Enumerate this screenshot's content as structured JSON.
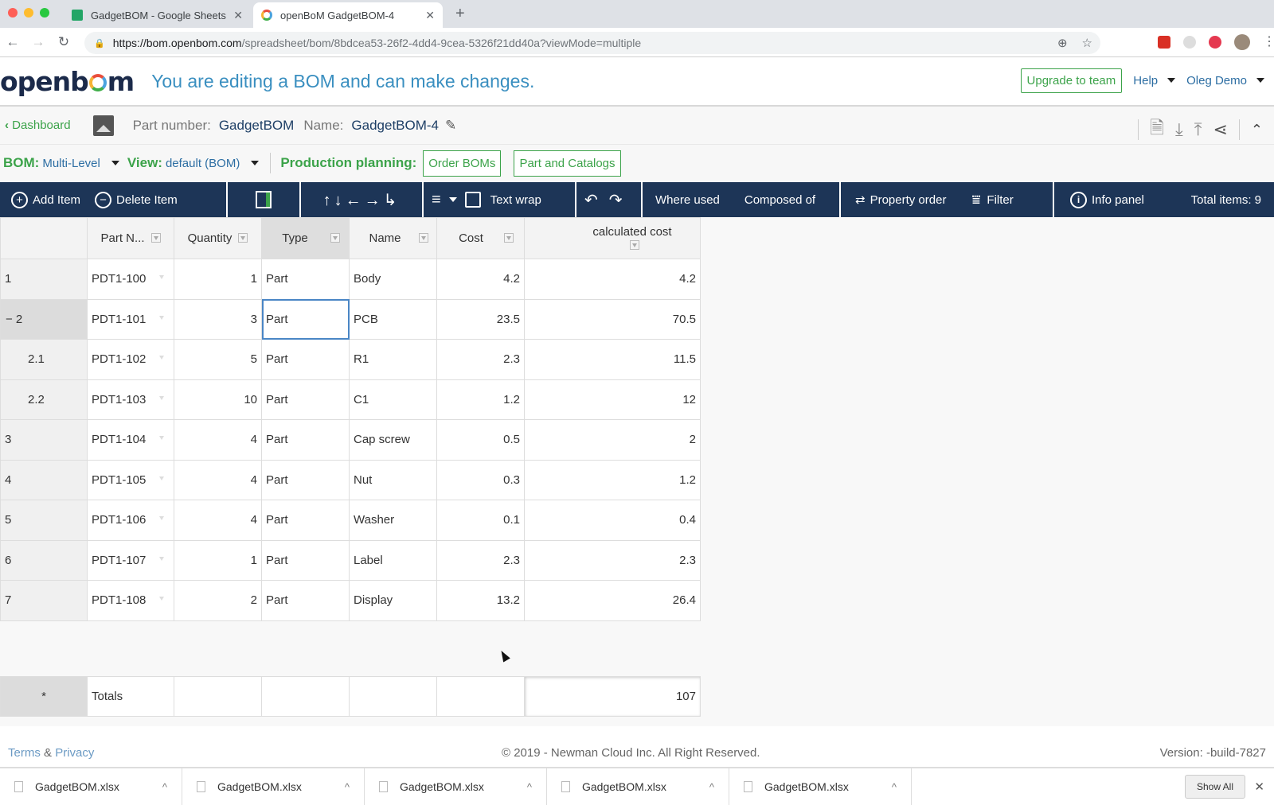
{
  "browser": {
    "tabs": [
      {
        "title": "GadgetBOM - Google Sheets",
        "favicon": "sheets-icon",
        "active": false
      },
      {
        "title": "openBoM GadgetBOM-4",
        "favicon": "openbom-icon",
        "active": true
      }
    ],
    "url_host": "https://bom.openbom.com",
    "url_path": "/spreadsheet/bom/8bdcea53-26f2-4dd4-9cea-5326f21dd40a?viewMode=multiple",
    "icons": [
      "back-icon",
      "forward-icon",
      "reload-icon",
      "lock-icon",
      "zoom-icon",
      "star-icon",
      "gmail-extension-icon",
      "circle-extension-icon",
      "red-extension-icon",
      "profile-avatar",
      "more-menu-icon"
    ]
  },
  "header": {
    "logo": "openbom",
    "edit_message": "You are editing a BOM and can make changes.",
    "upgrade_label": "Upgrade to team",
    "help_label": "Help",
    "user_label": "Oleg Demo"
  },
  "part": {
    "back_label": "Dashboard",
    "part_number_label": "Part number:",
    "part_number": "GadgetBOM",
    "name_label": "Name:",
    "name": "GadgetBOM-4",
    "actions": [
      "report-icon",
      "download-icon",
      "upload-icon",
      "share-icon",
      "collapse-icon"
    ]
  },
  "bomrow": {
    "bom_label": "BOM:",
    "bom_value": "Multi-Level",
    "view_label": "View:",
    "view_value": "default (BOM)",
    "production_label": "Production planning:",
    "order_boms": "Order BOMs",
    "part_catalogs": "Part and Catalogs"
  },
  "toolbar": {
    "add_item": "Add Item",
    "delete_item": "Delete Item",
    "text_wrap": "Text wrap",
    "where_used": "Where used",
    "composed_of": "Composed of",
    "property_order": "Property order",
    "filter": "Filter",
    "info_panel": "Info panel",
    "total_items": "Total items: 9",
    "arrows": "↑↓←→↳"
  },
  "grid": {
    "columns": [
      "Part N...",
      "Quantity",
      "Type",
      "Name",
      "Cost",
      "calculated cost"
    ],
    "rows": [
      {
        "num": "1",
        "pn": "PDT1-100",
        "qty": "1",
        "type": "Part",
        "name": "Body",
        "cost": "4.2",
        "calc": "4.2"
      },
      {
        "num": "− 2",
        "pn": "PDT1-101",
        "qty": "3",
        "type": "Part",
        "name": "PCB",
        "cost": "23.5",
        "calc": "70.5"
      },
      {
        "num": "2.1",
        "pn": "PDT1-102",
        "qty": "5",
        "type": "Part",
        "name": "R1",
        "cost": "2.3",
        "calc": "11.5"
      },
      {
        "num": "2.2",
        "pn": "PDT1-103",
        "qty": "10",
        "type": "Part",
        "name": "C1",
        "cost": "1.2",
        "calc": "12"
      },
      {
        "num": "3",
        "pn": "PDT1-104",
        "qty": "4",
        "type": "Part",
        "name": "Cap screw",
        "cost": "0.5",
        "calc": "2"
      },
      {
        "num": "4",
        "pn": "PDT1-105",
        "qty": "4",
        "type": "Part",
        "name": "Nut",
        "cost": "0.3",
        "calc": "1.2"
      },
      {
        "num": "5",
        "pn": "PDT1-106",
        "qty": "4",
        "type": "Part",
        "name": "Washer",
        "cost": "0.1",
        "calc": "0.4"
      },
      {
        "num": "6",
        "pn": "PDT1-107",
        "qty": "1",
        "type": "Part",
        "name": "Label",
        "cost": "2.3",
        "calc": "2.3"
      },
      {
        "num": "7",
        "pn": "PDT1-108",
        "qty": "2",
        "type": "Part",
        "name": "Display",
        "cost": "13.2",
        "calc": "26.4"
      }
    ],
    "totals": {
      "marker": "*",
      "label": "Totals",
      "value": "107"
    }
  },
  "footer": {
    "terms": "Terms",
    "amp": "&",
    "privacy": "Privacy",
    "copyright": "© 2019 - Newman Cloud Inc. All Right Reserved.",
    "version": "Version: -build-7827"
  },
  "downloads": {
    "files": [
      "GadgetBOM.xlsx",
      "GadgetBOM.xlsx",
      "GadgetBOM.xlsx",
      "GadgetBOM.xlsx",
      "GadgetBOM.xlsx"
    ],
    "show_all": "Show All"
  },
  "colors": {
    "toolbar_bg": "#1d3557",
    "accent_green": "#3ca34a",
    "link_blue": "#2d6ea3"
  }
}
